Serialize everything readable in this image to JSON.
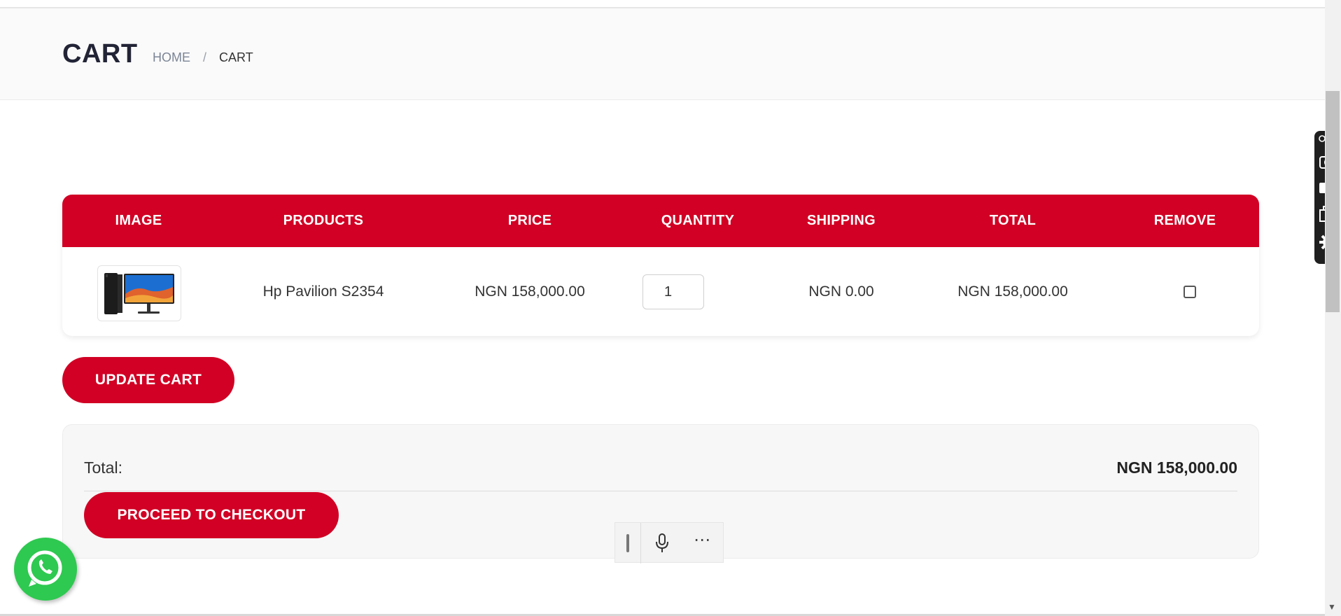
{
  "page": {
    "title": "CART"
  },
  "breadcrumb": {
    "home": "HOME",
    "separator": "/",
    "current": "CART"
  },
  "table": {
    "headers": [
      "IMAGE",
      "PRODUCTS",
      "PRICE",
      "QUANTITY",
      "SHIPPING",
      "TOTAL",
      "REMOVE"
    ],
    "rows": [
      {
        "image": "desktop-and-monitor",
        "product": "Hp Pavilion S2354",
        "price": "NGN 158,000.00",
        "quantity": "1",
        "shipping": "NGN 0.00",
        "total": "NGN 158,000.00",
        "remove": false
      }
    ]
  },
  "actions": {
    "update_cart": "UPDATE CART",
    "checkout": "PROCEED TO CHECKOUT"
  },
  "totals": {
    "label": "Total:",
    "value": "NGN 158,000.00"
  },
  "colors": {
    "brand": "#d10024",
    "whatsapp": "#2ec950"
  },
  "icons": [
    "whatsapp-icon",
    "mic-icon",
    "more-icon",
    "camera-icon",
    "video-icon",
    "windows-icon",
    "gear-icon",
    "link-icon"
  ]
}
